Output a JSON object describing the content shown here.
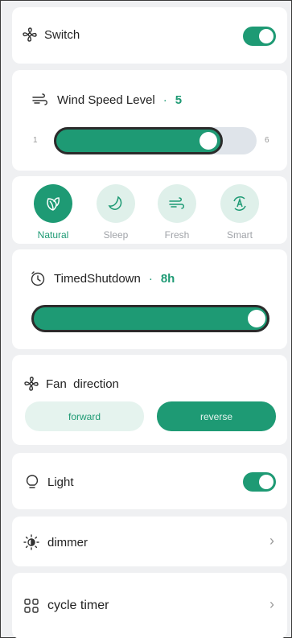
{
  "switch": {
    "label": "Switch",
    "on": true
  },
  "wind": {
    "label": "Wind Speed Level",
    "dot": "·",
    "value": "5",
    "min": "1",
    "max": "6",
    "level": 5
  },
  "modes": [
    {
      "label": "Natural",
      "icon": "leaf-icon",
      "active": true
    },
    {
      "label": "Sleep",
      "icon": "moon-icon",
      "active": false
    },
    {
      "label": "Fresh",
      "icon": "wind-icon",
      "active": false
    },
    {
      "label": "Smart",
      "icon": "auto-icon",
      "active": false
    }
  ],
  "timer": {
    "label": "TimedShutdown",
    "dot": "·",
    "value": "8h"
  },
  "direction": {
    "label": "Fan  direction",
    "forward": "forward",
    "reverse": "reverse",
    "selected": "reverse"
  },
  "light": {
    "label": "Light",
    "on": true
  },
  "dimmer": {
    "label": "dimmer"
  },
  "cycle": {
    "label": "cycle timer"
  },
  "colors": {
    "accent": "#1e9a74",
    "accent_light": "#dff0ea",
    "background": "#eff0f2"
  }
}
